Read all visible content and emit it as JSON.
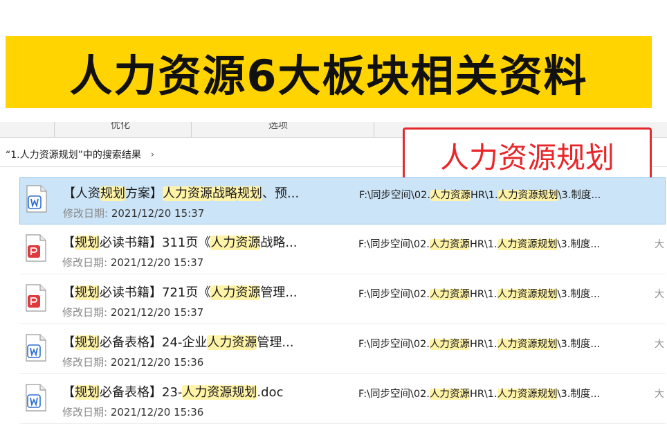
{
  "banner": {
    "title": "人力资源6大板块相关资料"
  },
  "ribbon": {
    "left": "优化",
    "right": "选项"
  },
  "breadcrumb": {
    "text": "“1.人力资源规划”中的搜索结果",
    "chevron": "›"
  },
  "callout": {
    "text": "人力资源规划"
  },
  "colors": {
    "banner": "#ffd400",
    "callout": "#e3292d",
    "highlight": "#fff3a8",
    "selected": "#cce4f7"
  },
  "meta_label": "修改日期:",
  "results": [
    {
      "icon": "word-doc-icon",
      "title_parts": [
        "【人资",
        "规划",
        "方案】",
        "人力资源",
        "战略",
        "规划",
        "、预..."
      ],
      "date": "2021/12/20 15:37",
      "path_parts": [
        "F:\\同步空间\\02.",
        "人力资源",
        "HR\\1.",
        "人力资源规划",
        "\\3.制度..."
      ],
      "trail": "",
      "selected": true
    },
    {
      "icon": "pdf-doc-icon",
      "title_parts": [
        "【",
        "规划",
        "必读书籍】311页《",
        "人力资源",
        "战略..."
      ],
      "date": "2021/12/20 15:37",
      "path_parts": [
        "F:\\同步空间\\02.",
        "人力资源",
        "HR\\1.",
        "人力资源规划",
        "\\3.制度..."
      ],
      "trail": "大",
      "selected": false
    },
    {
      "icon": "pdf-doc-icon",
      "title_parts": [
        "【",
        "规划",
        "必读书籍】721页《",
        "人力资源",
        "管理..."
      ],
      "date": "2021/12/20 15:37",
      "path_parts": [
        "F:\\同步空间\\02.",
        "人力资源",
        "HR\\1.",
        "人力资源规划",
        "\\3.制度..."
      ],
      "trail": "大",
      "selected": false
    },
    {
      "icon": "word-doc-icon",
      "title_parts": [
        "【",
        "规划",
        "必备表格】24-企业",
        "人力资源",
        "管理..."
      ],
      "date": "2021/12/20 15:36",
      "path_parts": [
        "F:\\同步空间\\02.",
        "人力资源",
        "HR\\1.",
        "人力资源规划",
        "\\3.制度..."
      ],
      "trail": "大",
      "selected": false
    },
    {
      "icon": "word-doc-icon",
      "title_parts": [
        "【",
        "规划",
        "必备表格】23-",
        "人力资源规划",
        ".doc"
      ],
      "date": "2021/12/20 15:36",
      "path_parts": [
        "F:\\同步空间\\02.",
        "人力资源",
        "HR\\1.",
        "人力资源规划",
        "\\3.制度..."
      ],
      "trail": "大",
      "selected": false
    }
  ]
}
